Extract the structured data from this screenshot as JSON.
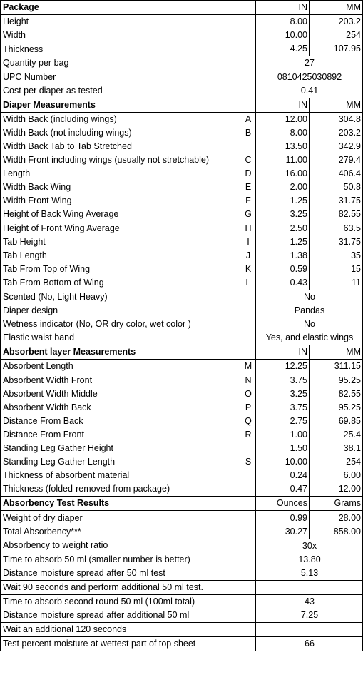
{
  "package": {
    "title": "Package",
    "unit_in": "IN",
    "unit_mm": "MM",
    "rows": [
      {
        "label": "Height",
        "in": "8.00",
        "mm": "203.2"
      },
      {
        "label": "Width",
        "in": "10.00",
        "mm": "254"
      },
      {
        "label": "Thickness",
        "in": "4.25",
        "mm": "107.95"
      }
    ],
    "merged_rows": [
      {
        "label": "Quantity per bag",
        "value": "27"
      },
      {
        "label": "UPC Number",
        "value": "0810425030892"
      },
      {
        "label": "Cost per diaper as tested",
        "value": "0.41"
      }
    ]
  },
  "diaper": {
    "title": "Diaper Measurements",
    "unit_in": "IN",
    "unit_mm": "MM",
    "rows": [
      {
        "label": "Width Back (including wings)",
        "letter": "A",
        "in": "12.00",
        "mm": "304.8"
      },
      {
        "label": "Width Back (not including wings)",
        "letter": "B",
        "in": "8.00",
        "mm": "203.2"
      },
      {
        "label": "Width Back Tab to Tab Stretched",
        "letter": "",
        "in": "13.50",
        "mm": "342.9"
      },
      {
        "label": "Width Front including wings (usually not stretchable)",
        "letter": "C",
        "in": "11.00",
        "mm": "279.4"
      },
      {
        "label": "Length",
        "letter": "D",
        "in": "16.00",
        "mm": "406.4"
      },
      {
        "label": "Width Back Wing",
        "letter": "E",
        "in": "2.00",
        "mm": "50.8"
      },
      {
        "label": "Width Front Wing",
        "letter": "F",
        "in": "1.25",
        "mm": "31.75"
      },
      {
        "label": "Height of Back Wing Average",
        "letter": "G",
        "in": "3.25",
        "mm": "82.55"
      },
      {
        "label": "Height of Front Wing Average",
        "letter": "H",
        "in": "2.50",
        "mm": "63.5"
      },
      {
        "label": "Tab Height",
        "letter": "I",
        "in": "1.25",
        "mm": "31.75"
      },
      {
        "label": "Tab Length",
        "letter": "J",
        "in": "1.38",
        "mm": "35"
      },
      {
        "label": "Tab From Top of Wing",
        "letter": "K",
        "in": "0.59",
        "mm": "15"
      },
      {
        "label": "Tab From Bottom of Wing",
        "letter": "L",
        "in": "0.43",
        "mm": "11"
      }
    ],
    "merged_rows": [
      {
        "label": "Scented (No, Light Heavy)",
        "value": "No"
      },
      {
        "label": "Diaper design",
        "value": "Pandas"
      },
      {
        "label": "Wetness indicator (No, OR dry color, wet color )",
        "value": "No"
      },
      {
        "label": "Elastic waist band",
        "value": "Yes, and elastic wings"
      }
    ]
  },
  "absorbent": {
    "title": "Absorbent layer Measurements",
    "unit_in": "IN",
    "unit_mm": "MM",
    "rows": [
      {
        "label": "Absorbent Length",
        "letter": "M",
        "in": "12.25",
        "mm": "311.15"
      },
      {
        "label": "Absorbent Width Front",
        "letter": "N",
        "in": "3.75",
        "mm": "95.25"
      },
      {
        "label": "Absorbent Width Middle",
        "letter": "O",
        "in": "3.25",
        "mm": "82.55"
      },
      {
        "label": "Absorbent Width Back",
        "letter": "P",
        "in": "3.75",
        "mm": "95.25"
      },
      {
        "label": "Distance From Back",
        "letter": "Q",
        "in": "2.75",
        "mm": "69.85"
      },
      {
        "label": "Distance From Front",
        "letter": "R",
        "in": "1.00",
        "mm": "25.4"
      },
      {
        "label": "Standing Leg Gather Height",
        "letter": "",
        "in": "1.50",
        "mm": "38.1"
      },
      {
        "label": "Standing Leg Gather Length",
        "letter": "S",
        "in": "10.00",
        "mm": "254"
      },
      {
        "label": "Thickness of absorbent material",
        "letter": "",
        "in": "0.24",
        "mm": "6.00"
      },
      {
        "label": "Thickness (folded-removed from package)",
        "letter": "",
        "in": "0.47",
        "mm": "12.00"
      }
    ]
  },
  "absorbency": {
    "title": "Absorbency Test Results",
    "unit_oz": "Ounces",
    "unit_g": "Grams",
    "rows": [
      {
        "label": "Weight of dry diaper",
        "oz": "0.99",
        "g": "28.00"
      },
      {
        "label": "Total Absorbency***",
        "oz": "30.27",
        "g": "858.00"
      }
    ],
    "merged_rows": [
      {
        "label": "Absorbency to weight ratio",
        "value": "30x"
      },
      {
        "label": "Time to absorb 50 ml (smaller number is better)",
        "value": "13.80"
      },
      {
        "label": "Distance moisture spread after 50 ml test",
        "value": "5.13"
      }
    ],
    "wait_90": {
      "label": "Wait 90 seconds and perform additional 50 ml test.",
      "rows": [
        {
          "label": "Time to absorb second round 50 ml  (100ml total)",
          "value": "43"
        },
        {
          "label": "Distance moisture spread after additional 50 ml",
          "value": "7.25"
        }
      ]
    },
    "wait_120": {
      "label": "Wait an additional 120 seconds",
      "rows": [
        {
          "label": "Test percent moisture at wettest part of top sheet",
          "value": "66"
        }
      ]
    }
  }
}
